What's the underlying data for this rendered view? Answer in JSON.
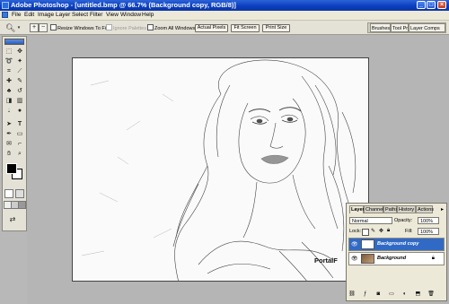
{
  "window": {
    "title": "Adobe Photoshop - [untitled.bmp @ 66.7% (Background copy, RGB/8)]",
    "min_glyph": "_",
    "max_glyph": "□",
    "close_glyph": "×"
  },
  "menu": [
    "File",
    "Edit",
    "Image",
    "Layer",
    "Select",
    "Filter",
    "View",
    "Window",
    "Help"
  ],
  "options": {
    "resize_windows": "Resize Windows To Fit",
    "ignore_palettes": "Ignore Palettes",
    "zoom_all": "Zoom All Windows",
    "actual_pixels": "Actual Pixels",
    "fit_screen": "Fit Screen",
    "print_size": "Print Size"
  },
  "palette_well": [
    "Brushes",
    "Tool Pr",
    "Layer Comps"
  ],
  "watermark": "PortalF",
  "layers_panel": {
    "tabs": [
      "Layers",
      "Channels",
      "Paths",
      "History",
      "Actions"
    ],
    "blend_mode": "Normal",
    "opacity_label": "Opacity:",
    "opacity": "100%",
    "lock_label": "Lock:",
    "fill_label": "Fill:",
    "fill": "100%",
    "layers": [
      {
        "name": "Background copy",
        "active": true
      },
      {
        "name": "Background",
        "active": false
      }
    ]
  },
  "colors": {
    "title_bar": "#0a3fbf",
    "selected_layer": "#316ac5",
    "ui_bg": "#ece9d8"
  }
}
